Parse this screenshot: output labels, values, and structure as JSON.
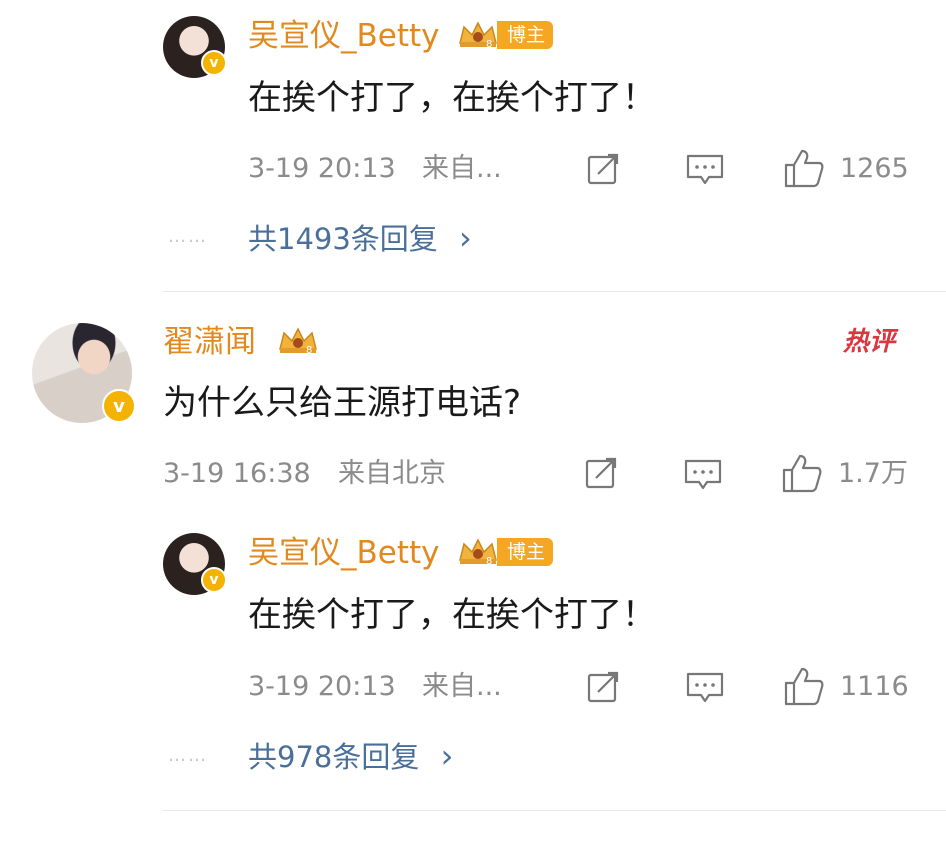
{
  "comments": [
    {
      "user": {
        "name": "吴宣仪_Betty",
        "badge": "博主",
        "verified_mark": "v"
      },
      "text": "在挨个打了，在挨个打了！",
      "time": "3-19 20:13",
      "source": "来自...",
      "likes": "1265",
      "replies_label": "共1493条回复",
      "replies_dots": "……",
      "replies_arrow": "›"
    },
    {
      "user": {
        "name": "翟潇闻",
        "verified_mark": "v"
      },
      "hot_label": "热评",
      "text": "为什么只给王源打电话?",
      "time": "3-19 16:38",
      "source": "来自北京",
      "likes": "1.7万"
    },
    {
      "user": {
        "name": "吴宣仪_Betty",
        "badge": "博主",
        "verified_mark": "v"
      },
      "text": "在挨个打了，在挨个打了！",
      "time": "3-19 20:13",
      "source": "来自...",
      "likes": "1116",
      "replies_label": "共978条回复",
      "replies_dots": "……",
      "replies_arrow": "›"
    }
  ],
  "icons": {
    "share": "share-icon",
    "comment": "comment-icon",
    "like": "thumbs-up-icon",
    "crown": "crown-icon"
  },
  "colors": {
    "username": "#e2891d",
    "reply_link": "#4a6f9a",
    "meta": "#8b8b8b",
    "badge_bg": "#f5a623",
    "verified": "#f5b301",
    "hot": "#d9363e"
  }
}
